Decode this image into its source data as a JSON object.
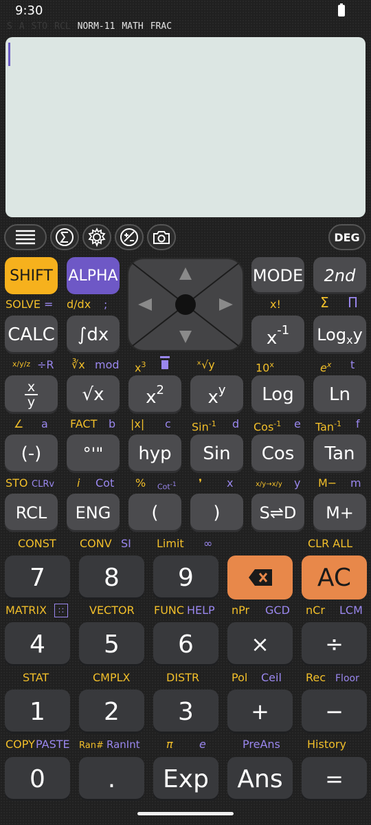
{
  "status": {
    "time": "9:30"
  },
  "indicators": [
    "S",
    "A",
    "STO",
    "RCL"
  ],
  "modes": [
    "NORM-11",
    "MATH",
    "FRAC"
  ],
  "toolbar": {
    "deg_label": "DEG"
  },
  "icons": {
    "menu": "menu-icon",
    "sigma": "sigma-icon",
    "settings": "gear-icon",
    "plusminus": "plus-minus-icon",
    "camera": "camera-icon"
  },
  "keys": {
    "shift": "SHIFT",
    "alpha": "ALPHA",
    "mode": "MODE",
    "second": "2nd",
    "calc": "CALC",
    "integral": "∫dx",
    "inverse_base": "x",
    "inverse_exp": "-1",
    "log_base_main": "Log",
    "log_base_sub": "x",
    "log_base_y": "y",
    "frac_num": "x",
    "frac_den": "y",
    "sqrt": "√x",
    "square_base": "x",
    "square_exp": "2",
    "power_base": "x",
    "power_exp": "y",
    "log": "Log",
    "ln": "Ln",
    "negative": "(-)",
    "dms": "°'\"",
    "hyp": "hyp",
    "sin": "Sin",
    "cos": "Cos",
    "tan": "Tan",
    "rcl": "RCL",
    "eng": "ENG",
    "open_paren": "(",
    "close_paren": ")",
    "sd": "S⇌D",
    "mplus": "M+",
    "n7": "7",
    "n8": "8",
    "n9": "9",
    "ac": "AC",
    "n4": "4",
    "n5": "5",
    "n6": "6",
    "multiply": "×",
    "divide": "÷",
    "n1": "1",
    "n2": "2",
    "n3": "3",
    "plus": "+",
    "minus": "−",
    "n0": "0",
    "dot": ".",
    "exp": "Exp",
    "ans": "Ans",
    "equals": "="
  },
  "labels": {
    "solve": "SOLVE",
    "solve_eq": "=",
    "ddx": "d/dx",
    "semicolon": ";",
    "xfact": "x!",
    "sigma": "Σ",
    "pi_prod": "Π",
    "xyz": "x/y/z",
    "divr": "÷R",
    "cbrt": "∛x",
    "mod": "mod",
    "cube_b": "x",
    "cube_e": "3",
    "xroot": "ˣ√y",
    "tenx_b": "10",
    "tenx_e": "x",
    "ex_b": "e",
    "ex_e": "x",
    "t": "t",
    "angle": "∠",
    "a": "a",
    "fact": "FACT",
    "b": "b",
    "abs": "|x|",
    "c": "c",
    "sininv": "Sin",
    "sininv_e": "-1",
    "d": "d",
    "cosinv": "Cos",
    "cosinv_e": "-1",
    "e": "e",
    "taninv": "Tan",
    "taninv_e": "-1",
    "f": "f",
    "sto": "STO",
    "clrv": "CLRv",
    "i": "i",
    "cot": "Cot",
    "percent": "%",
    "cotinv": "Cot",
    "cotinv_e": "-1",
    "comma": "❜",
    "x": "x",
    "xyconv": "x/y→x/y",
    "y": "y",
    "mminus": "M−",
    "m": "m",
    "const": "CONST",
    "conv": "CONV",
    "si": "SI",
    "limit": "Limit",
    "infinity": "∞",
    "clrall": "CLR ALL",
    "matrix": "MATRIX",
    "vector": "VECTOR",
    "func": "FUNC",
    "help": "HELP",
    "npr": "nPr",
    "gcd": "GCD",
    "ncr": "nCr",
    "lcm": "LCM",
    "stat": "STAT",
    "cmplx": "CMPLX",
    "distr": "DISTR",
    "pol": "Pol",
    "ceil": "Ceil",
    "rec": "Rec",
    "floor": "Floor",
    "copy": "COPY",
    "paste": "PASTE",
    "ranhash": "Ran#",
    "ranint": "RanInt",
    "pi": "π",
    "econst": "e",
    "preans": "PreAns",
    "history": "History"
  }
}
